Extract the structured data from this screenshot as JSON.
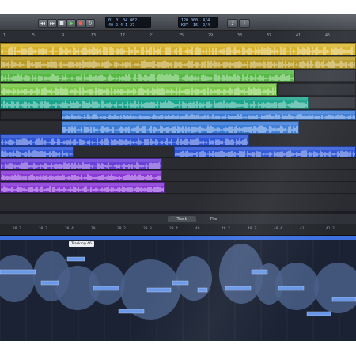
{
  "toolbar": {
    "buttons": [
      {
        "name": "rewind-button",
        "icon": "rewind-icon",
        "glyph": "◂◂"
      },
      {
        "name": "forward-button",
        "icon": "fast-forward-icon",
        "glyph": "▸▸"
      },
      {
        "name": "stop-button",
        "icon": "stop-icon",
        "glyph": "■"
      },
      {
        "name": "play-button",
        "icon": "play-icon",
        "glyph": "▶"
      },
      {
        "name": "record-button",
        "icon": "record-icon",
        "glyph": "●"
      },
      {
        "name": "cycle-button",
        "icon": "cycle-icon",
        "glyph": "↻"
      }
    ],
    "lcd_position": "01 01 04.062\n40 2 4 1 27",
    "lcd_tempo": "120.000  4/4\nKEY  16  2/4"
  },
  "colors": {
    "yellow": "#d8b32a",
    "yellow_dark": "#b99a24",
    "green": "#55b944",
    "green_light": "#7cc94a",
    "teal": "#1aa58d",
    "blue_light": "#3b7bd8",
    "blue": "#2d56d6",
    "violet": "#6a3fd8",
    "purple": "#8a39d6",
    "editor_note": "#6a97e6",
    "editor_wave": "#4a5f88"
  },
  "ruler_marks": [
    "1",
    "5",
    "9",
    "13",
    "17",
    "21",
    "25",
    "29",
    "33",
    "37",
    "41",
    "45"
  ],
  "tabs": [
    {
      "label": "Track",
      "active": true
    },
    {
      "label": "File",
      "active": false
    }
  ],
  "editor_ruler_marks": [
    "38 2",
    "38 3",
    "38 4",
    "39",
    "39 2",
    "39 3",
    "39 4",
    "40",
    "40 2",
    "40 3",
    "40 4",
    "41",
    "41 2"
  ],
  "tooltip": "Tracking  46"
}
